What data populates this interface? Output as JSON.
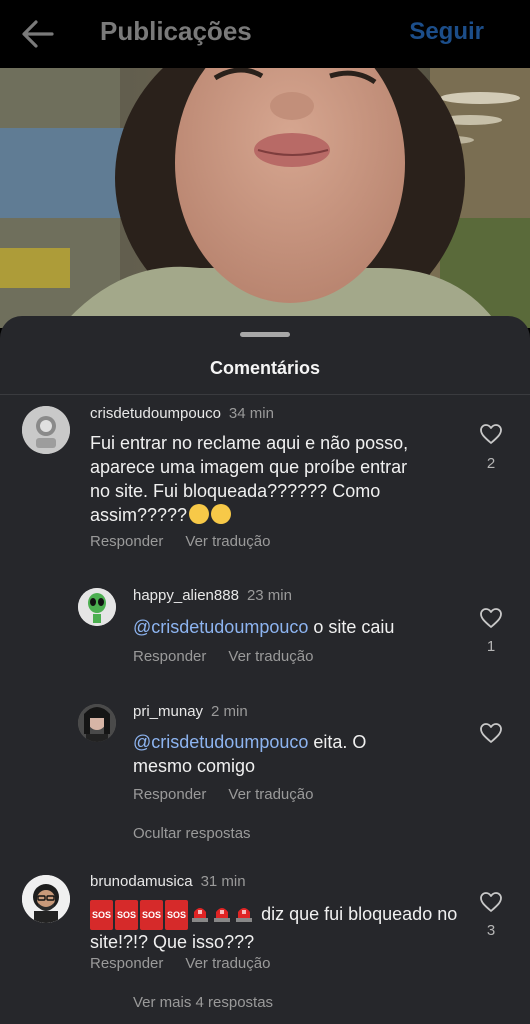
{
  "header": {
    "title": "Publicações",
    "follow_label": "Seguir"
  },
  "sheet": {
    "title": "Comentários"
  },
  "comments": [
    {
      "username": "crisdetudoumpouco",
      "time": "34 min",
      "text": "Fui entrar no reclame aqui e não posso, aparece uma imagem que proíbe entrar no site. Fui bloqueada?????? Como assim?????",
      "reply_label": "Responder",
      "translate_label": "Ver tradução",
      "likes": "2",
      "replies": [
        {
          "username": "happy_alien888",
          "time": "23 min",
          "mention": "@crisdetudoumpouco",
          "text": " o site caiu",
          "reply_label": "Responder",
          "translate_label": "Ver tradução",
          "likes": "1"
        },
        {
          "username": "pri_munay",
          "time": "2 min",
          "mention": "@crisdetudoumpouco",
          "text": " eita. O mesmo comigo",
          "reply_label": "Responder",
          "translate_label": "Ver tradução",
          "likes": ""
        }
      ],
      "hide_replies_label": "Ocultar respostas"
    },
    {
      "username": "brunodamusica",
      "time": "31 min",
      "sos_label": "SOS",
      "text": " diz que fui bloqueado no site!?!? Que isso???",
      "reply_label": "Responder",
      "translate_label": "Ver tradução",
      "likes": "3",
      "more_replies_label": "Ver mais 4 respostas"
    }
  ],
  "colors": {
    "sheet_bg": "#26272b",
    "mention": "#8db4f0",
    "follow": "#1c4e8a"
  }
}
